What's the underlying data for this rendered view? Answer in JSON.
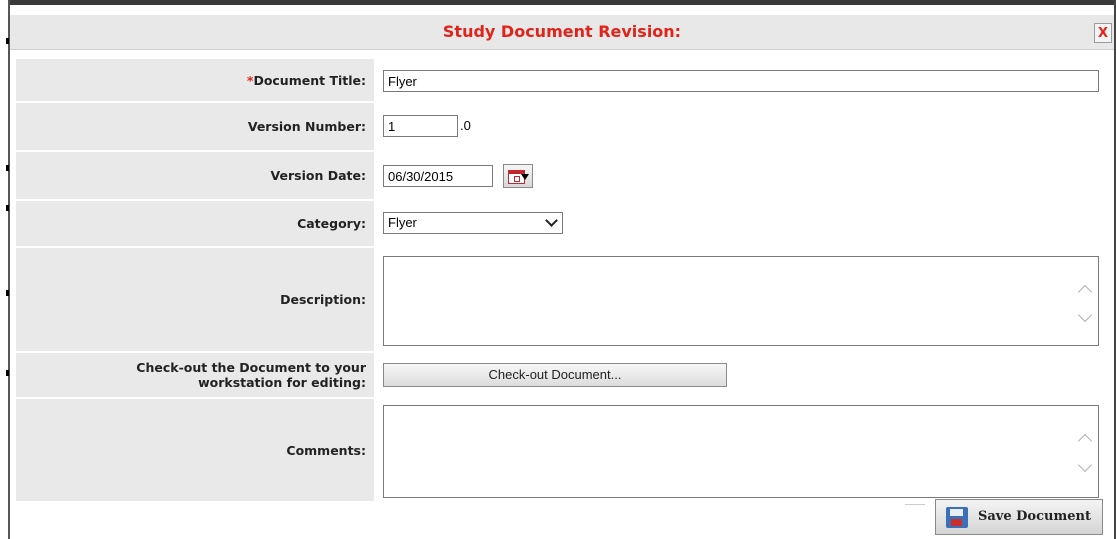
{
  "dialog": {
    "title": "Study Document Revision:",
    "close_label": "X"
  },
  "form": {
    "document_title": {
      "required_mark": "*",
      "label": "Document Title:",
      "value": "Flyer"
    },
    "version_number": {
      "label": "Version Number:",
      "value": "1",
      "suffix": ".0"
    },
    "version_date": {
      "label": "Version Date:",
      "value": "06/30/2015"
    },
    "category": {
      "label": "Category:",
      "selected": "Flyer"
    },
    "description": {
      "label": "Description:",
      "value": ""
    },
    "checkout": {
      "label_line1": "Check-out the Document to your",
      "label_line2": "workstation for editing:",
      "button_label": "Check-out Document..."
    },
    "comments": {
      "label": "Comments:",
      "value": ""
    }
  },
  "footer": {
    "save_label": "Save Document"
  },
  "colors": {
    "title_red": "#e2231a",
    "label_bg": "#e9e9e9"
  }
}
